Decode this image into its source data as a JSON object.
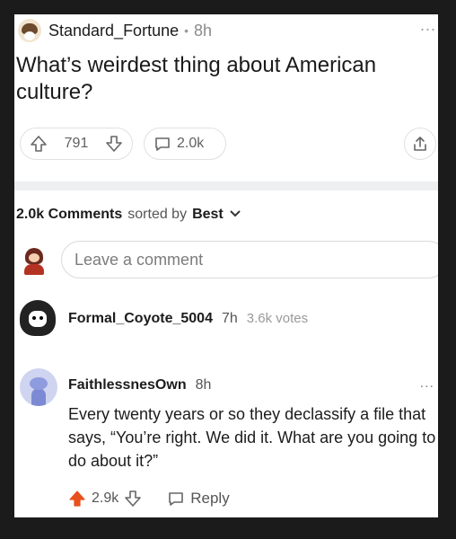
{
  "post": {
    "username": "Standard_Fortune",
    "separator": "•",
    "time": "8h",
    "more": "...",
    "title": "What’s weirdest thing about American culture?",
    "upvotes": "791",
    "comments": "2.0k"
  },
  "comments_bar": {
    "count": "2.0k Comments",
    "sorted_by": "sorted by",
    "sort_value": "Best"
  },
  "comment_input": {
    "placeholder": "Leave a comment"
  },
  "comment1": {
    "username": "Formal_Coyote_5004",
    "time": "7h",
    "votes": "3.6k votes"
  },
  "comment2": {
    "username": "FaithlessnesOwn",
    "time": "8h",
    "more": "...",
    "body": "Every twenty years or so they declassify a file that says, “You’re right. We did it. What are you going to do about it?”",
    "upvotes": "2.9k",
    "reply_label": "Reply"
  },
  "colors": {
    "upvote_active": "#e8501c",
    "frame": "#1b1b1b",
    "divider": "#edeff1"
  }
}
